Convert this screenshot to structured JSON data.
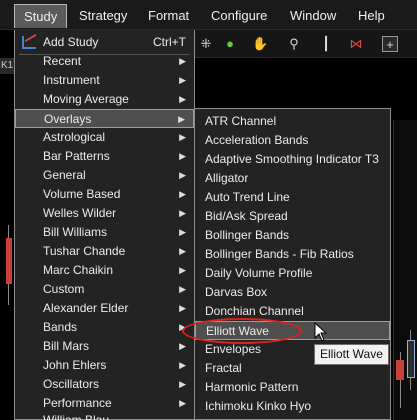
{
  "menubar": {
    "items": [
      {
        "label": "Study",
        "active": true
      },
      {
        "label": "Strategy"
      },
      {
        "label": "Format"
      },
      {
        "label": "Configure"
      },
      {
        "label": "Window"
      },
      {
        "label": "Help"
      }
    ]
  },
  "left_tab_text": "K1",
  "study_menu": {
    "items": [
      {
        "label": "Add Study",
        "shortcut": "Ctrl+T",
        "icon": "add-study-icon"
      },
      {
        "label": "Recent",
        "submenu": true
      },
      {
        "label": "Instrument",
        "submenu": true
      },
      {
        "label": "Moving Average",
        "submenu": true
      },
      {
        "label": "Overlays",
        "submenu": true,
        "highlighted": true
      },
      {
        "label": "Astrological",
        "submenu": true
      },
      {
        "label": "Bar Patterns",
        "submenu": true
      },
      {
        "label": "General",
        "submenu": true
      },
      {
        "label": "Volume Based",
        "submenu": true
      },
      {
        "label": "Welles Wilder",
        "submenu": true
      },
      {
        "label": "Bill Williams",
        "submenu": true
      },
      {
        "label": "Tushar Chande",
        "submenu": true
      },
      {
        "label": "Marc Chaikin",
        "submenu": true
      },
      {
        "label": "Custom",
        "submenu": true
      },
      {
        "label": "Alexander Elder",
        "submenu": true
      },
      {
        "label": "Bands",
        "submenu": true
      },
      {
        "label": "Bill Mars",
        "submenu": true
      },
      {
        "label": "John Ehlers",
        "submenu": true
      },
      {
        "label": "Oscillators",
        "submenu": true
      },
      {
        "label": "Performance",
        "submenu": true
      },
      {
        "label": "William Blau",
        "submenu": true
      }
    ]
  },
  "overlays_menu": {
    "items": [
      {
        "label": "ATR Channel"
      },
      {
        "label": "Acceleration Bands"
      },
      {
        "label": "Adaptive Smoothing Indicator T3"
      },
      {
        "label": "Alligator"
      },
      {
        "label": "Auto Trend Line"
      },
      {
        "label": "Bid/Ask Spread"
      },
      {
        "label": "Bollinger Bands"
      },
      {
        "label": "Bollinger Bands - Fib Ratios"
      },
      {
        "label": "Daily Volume Profile"
      },
      {
        "label": "Darvas Box"
      },
      {
        "label": "Donchian Channel"
      },
      {
        "label": "Elliott Wave",
        "highlighted": true
      },
      {
        "label": "Envelopes"
      },
      {
        "label": "Fractal"
      },
      {
        "label": "Harmonic Pattern"
      },
      {
        "label": "Ichimoku Kinko Hyo"
      }
    ]
  },
  "tooltip": {
    "text": "Elliott Wave"
  },
  "colors": {
    "highlight": "#4f4f4f",
    "menu_bg": "#232323",
    "annotation_red": "#e0201c",
    "candle_red": "#c8403a"
  },
  "toolbar_icons": [
    "crosshair-icon",
    "refresh-icon",
    "pan-hand-icon",
    "zoom-icon",
    "candlestick-icon",
    "indicator-icon",
    "add-icon"
  ]
}
